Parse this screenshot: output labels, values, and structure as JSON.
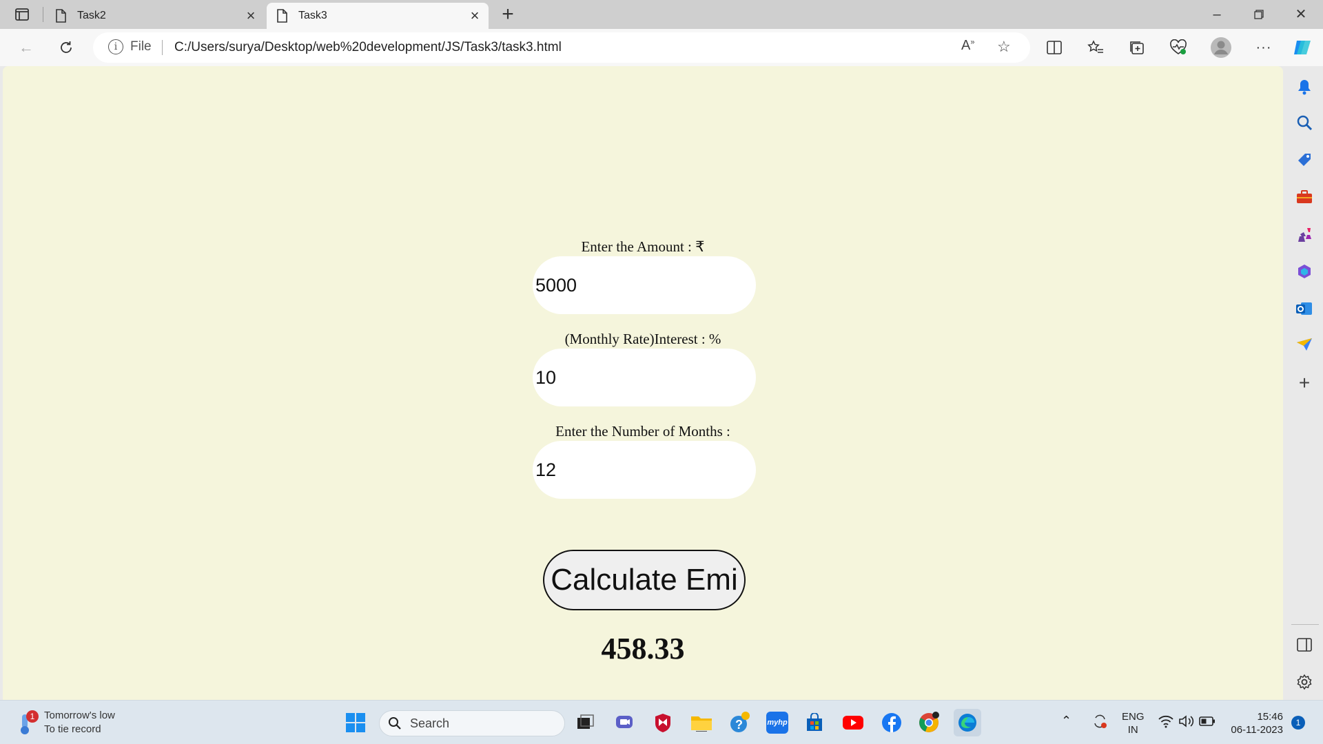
{
  "browser": {
    "tabs": [
      {
        "title": "Task2",
        "active": false
      },
      {
        "title": "Task3",
        "active": true
      }
    ],
    "address": {
      "scheme_label": "File",
      "url": "C:/Users/surya/Desktop/web%20development/JS/Task3/task3.html"
    }
  },
  "page": {
    "amount_label": "Enter the Amount : ₹",
    "amount_value": "5000",
    "rate_label": "(Monthly Rate)Interest : %",
    "rate_value": "10",
    "months_label": "Enter the Number of Months :",
    "months_value": "12",
    "calc_button": "Calculate Emi",
    "result": "458.33"
  },
  "taskbar": {
    "weather_line1": "Tomorrow's low",
    "weather_line2": "To tie record",
    "weather_badge": "1",
    "search_label": "Search",
    "lang_line1": "ENG",
    "lang_line2": "IN",
    "time": "15:46",
    "date": "06-11-2023",
    "notification_count": "1"
  },
  "colors": {
    "page_bg": "#f5f5dc",
    "edge_accent": "#0078d4"
  }
}
